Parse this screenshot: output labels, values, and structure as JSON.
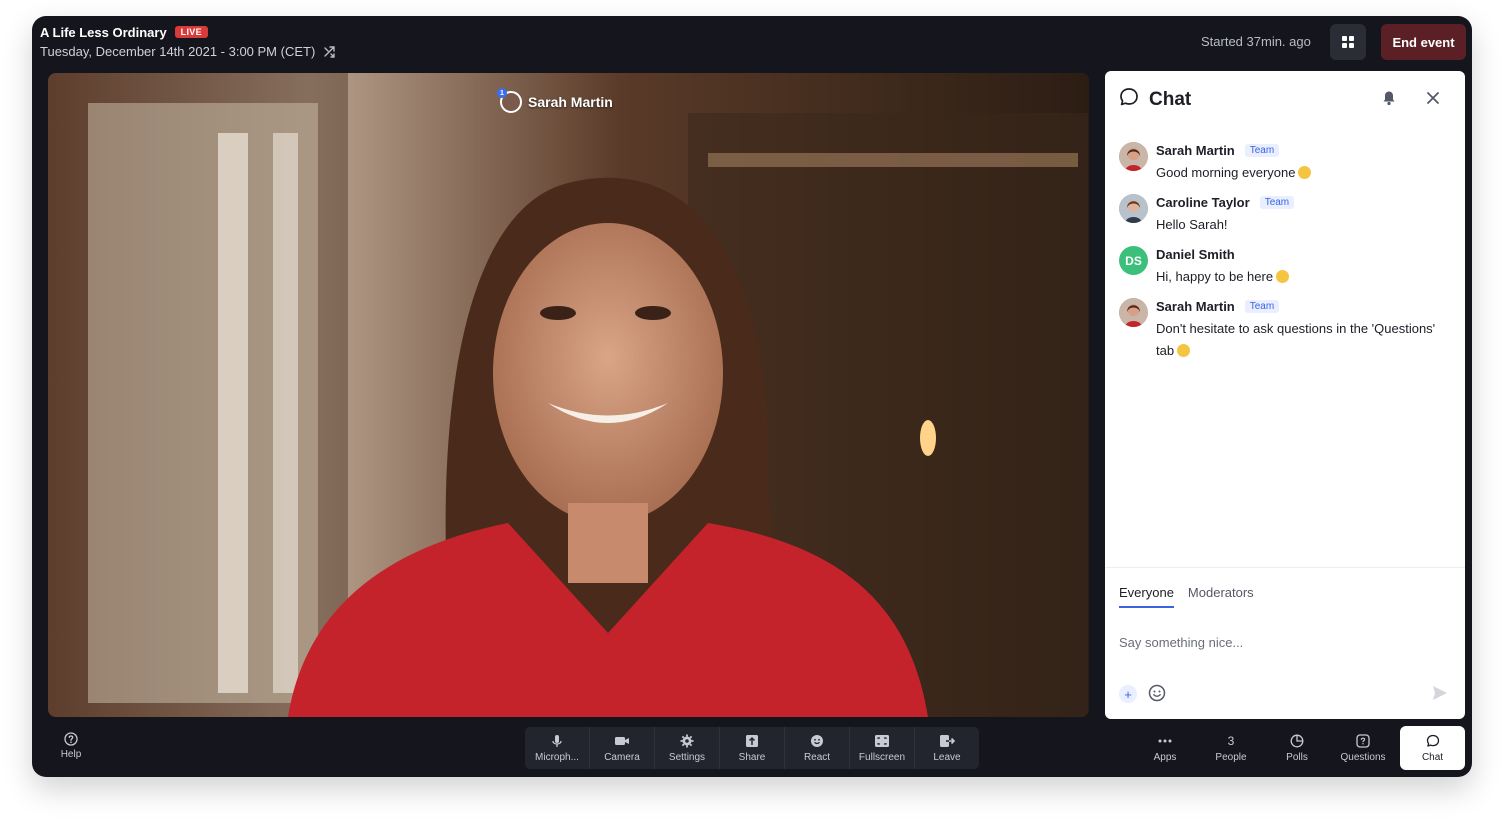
{
  "header": {
    "title": "A Life Less Ordinary",
    "live_badge": "LIVE",
    "date": "Tuesday, December 14th 2021 - 3:00 PM (CET)",
    "started": "Started 37min. ago",
    "end_button": "End event"
  },
  "video": {
    "speaker_name": "Sarah Martin",
    "speaker_badge": "1"
  },
  "chat": {
    "title": "Chat",
    "messages": [
      {
        "name": "Sarah Martin",
        "badge": "Team",
        "text": "Good morning everyone"
      },
      {
        "name": "Caroline Taylor",
        "badge": "Team",
        "text": "Hello Sarah!"
      },
      {
        "name": "Daniel Smith",
        "initials": "DS",
        "text": "Hi, happy to be here"
      },
      {
        "name": "Sarah Martin",
        "badge": "Team",
        "text": "Don't hesitate to ask questions in the 'Questions' tab"
      }
    ],
    "tabs": [
      "Everyone",
      "Moderators"
    ],
    "input_placeholder": "Say something nice..."
  },
  "toolbar": {
    "help": "Help",
    "items": [
      "Microph...",
      "Camera",
      "Settings",
      "Share",
      "React",
      "Fullscreen",
      "Leave"
    ]
  },
  "right_nav": {
    "apps": "Apps",
    "people_count": "3",
    "people": "People",
    "polls": "Polls",
    "questions": "Questions",
    "chat": "Chat"
  },
  "colors": {
    "background": "#15161d",
    "live": "#d93b3b",
    "end_button": "#5b2026",
    "accent": "#3b63e0",
    "avatar_ds": "#3bbf7a"
  }
}
